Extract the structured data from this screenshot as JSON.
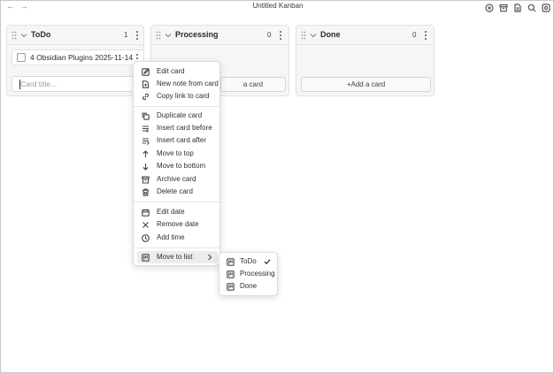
{
  "window": {
    "title": "Untitled Kanban",
    "back_icon": "arrow-left-icon",
    "forward_icon": "arrow-right-icon",
    "toolbar_icons": [
      "add-circle-icon",
      "archive-icon",
      "document-icon",
      "search-icon",
      "settings-icon"
    ]
  },
  "lanes": [
    {
      "title": "ToDo",
      "count": "1"
    },
    {
      "title": "Processing",
      "count": "0"
    },
    {
      "title": "Done",
      "count": "0"
    }
  ],
  "card": {
    "text": "4 Obsidian Plugins  2025-11-14"
  },
  "card_input": {
    "placeholder": "Card title..."
  },
  "add_card_label": "+Add a card",
  "add_card_label_partial": "a card",
  "context_menu": {
    "items": [
      {
        "label": "Edit card",
        "icon": "edit-icon"
      },
      {
        "label": "New note from card",
        "icon": "new-note-icon"
      },
      {
        "label": "Copy link to card",
        "icon": "link-icon"
      },
      {
        "label": "Duplicate card",
        "icon": "duplicate-icon"
      },
      {
        "label": "Insert card before",
        "icon": "insert-before-icon"
      },
      {
        "label": "Insert card after",
        "icon": "insert-after-icon"
      },
      {
        "label": "Move to top",
        "icon": "arrow-up-icon"
      },
      {
        "label": "Move to bottom",
        "icon": "arrow-down-icon"
      },
      {
        "label": "Archive card",
        "icon": "archive-icon"
      },
      {
        "label": "Delete card",
        "icon": "trash-icon"
      },
      {
        "label": "Edit date",
        "icon": "calendar-icon"
      },
      {
        "label": "Remove date",
        "icon": "x-icon"
      },
      {
        "label": "Add time",
        "icon": "clock-icon"
      },
      {
        "label": "Move to list",
        "icon": "list-icon"
      }
    ]
  },
  "submenu": {
    "items": [
      {
        "label": "ToDo",
        "icon": "list-icon",
        "checked": true
      },
      {
        "label": "Processing",
        "icon": "list-icon",
        "checked": false
      },
      {
        "label": "Done",
        "icon": "list-icon",
        "checked": false
      }
    ]
  }
}
